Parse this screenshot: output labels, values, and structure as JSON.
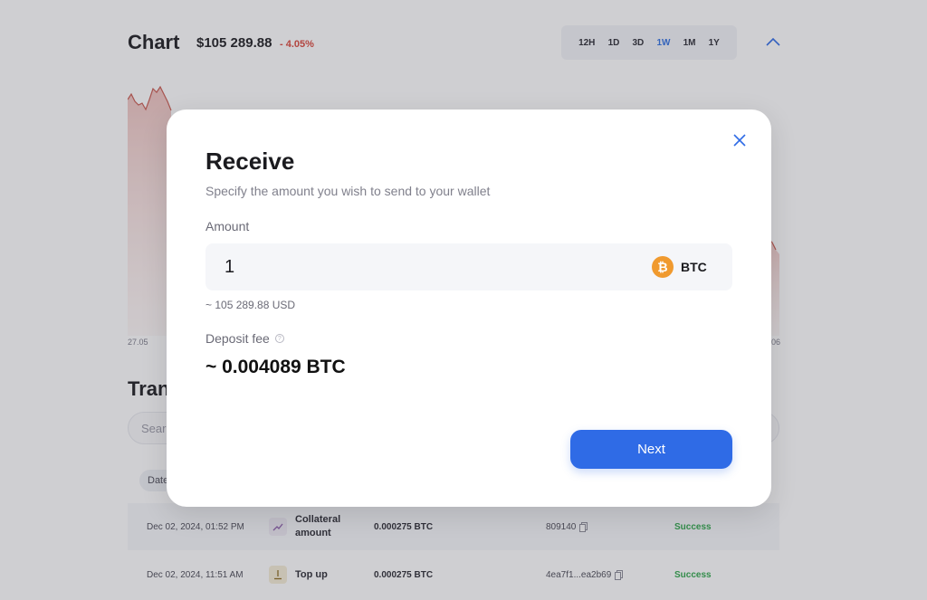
{
  "background": {
    "chart": {
      "title": "Chart",
      "price": "$105 289.88",
      "change": "- 4.05%",
      "ranges": [
        "12H",
        "1D",
        "3D",
        "1W",
        "1M",
        "1Y"
      ],
      "active_range": "1W",
      "x_label_left": "27.05",
      "x_label_right": "06"
    },
    "transactions": {
      "title": "Tran",
      "search_placeholder": "Sear",
      "column_chip": "Date",
      "rows": [
        {
          "date": "Dec 02, 2024, 01:52 PM",
          "type_line1": "Collateral",
          "type_line2": "amount",
          "amount": "0.000275 BTC",
          "hash": "809140",
          "status": "Success"
        },
        {
          "date": "Dec 02, 2024, 11:51 AM",
          "type_line1": "Top up",
          "type_line2": "",
          "amount": "0.000275 BTC",
          "hash": "4ea7f1...ea2b69",
          "status": "Success"
        }
      ]
    }
  },
  "modal": {
    "title": "Receive",
    "subtitle": "Specify the amount you wish to send to your wallet",
    "amount_label": "Amount",
    "amount_value": "1",
    "currency": "BTC",
    "currency_icon": "bitcoin-icon",
    "usd_estimate": "~ 105 289.88 USD",
    "fee_label": "Deposit fee",
    "fee_value": "~ 0.004089 BTC",
    "next_label": "Next"
  },
  "colors": {
    "accent": "#2f6be6",
    "btc_orange": "#f09a2f",
    "negative": "#d9463a",
    "success": "#2ea64a"
  }
}
